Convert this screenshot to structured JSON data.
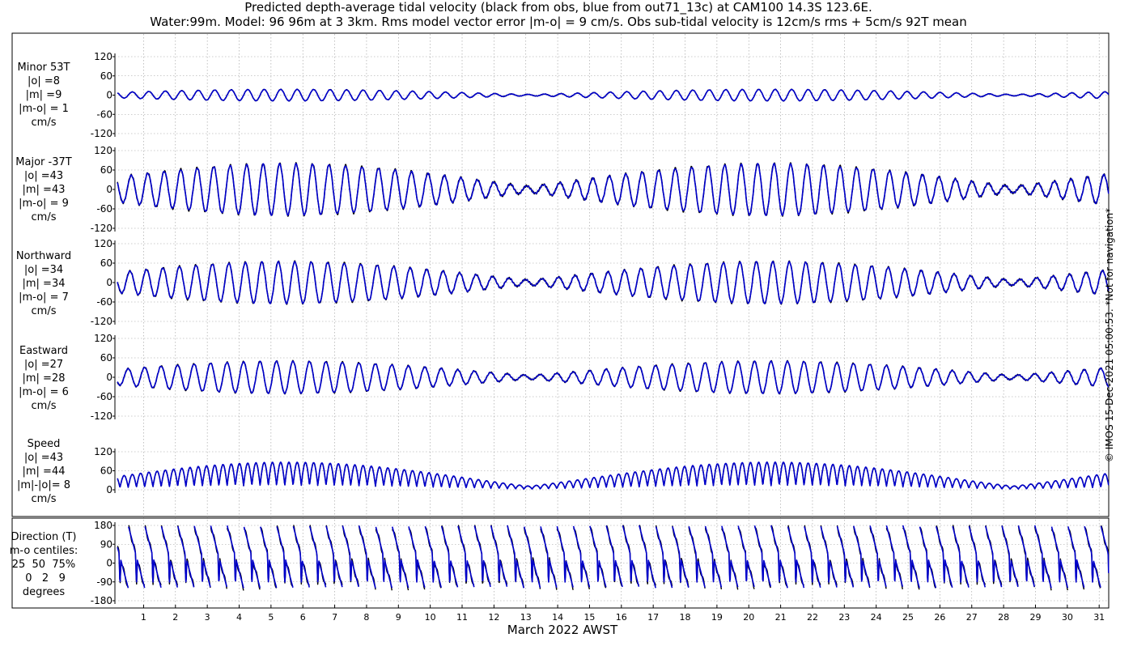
{
  "titles": {
    "line1": "Predicted depth-average tidal velocity (black from obs, blue from out71_13c) at CAM100 14.3S 123.6E.",
    "line2": "Water:99m. Model: 96 96m at 3 3km. Rms model vector error |m-o| = 9 cm/s. Obs sub-tidal velocity is 12cm/s rms + 5cm/s 92T mean"
  },
  "side_note": "© IMOS 15-Dec-2021 05:00:53. *Not for navigation*",
  "colors": {
    "obs": "#000000",
    "model": "#0000cc",
    "grid": "#999999"
  },
  "chart_data": {
    "type": "line",
    "xlabel": "March 2022 AWST",
    "x_ticks": [
      "1",
      "2",
      "3",
      "4",
      "5",
      "6",
      "7",
      "8",
      "9",
      "10",
      "11",
      "12",
      "13",
      "14",
      "15",
      "16",
      "17",
      "18",
      "19",
      "20",
      "21",
      "22",
      "23",
      "24",
      "25",
      "26",
      "27",
      "28",
      "29",
      "30",
      "31"
    ],
    "xlim_days": [
      0.1,
      31.3
    ],
    "series_names": [
      "obs",
      "model"
    ],
    "panels": [
      {
        "key": "minor",
        "label_lines": [
          "Minor 53T",
          "|o| =8",
          "|m| =9",
          "|m-o| = 1",
          "cm/s"
        ],
        "ylim": [
          -120,
          120
        ],
        "y_ticks": [
          "120",
          "60",
          "0",
          "-60",
          "-120"
        ],
        "kind": "signed",
        "peak_amplitude": 18
      },
      {
        "key": "major",
        "label_lines": [
          "Major -37T",
          "|o| =43",
          "|m| =43",
          "|m-o| = 9",
          "cm/s"
        ],
        "ylim": [
          -120,
          120
        ],
        "y_ticks": [
          "120",
          "60",
          "0",
          "-60",
          "-120"
        ],
        "kind": "signed",
        "peak_amplitude": 80
      },
      {
        "key": "northward",
        "label_lines": [
          "Northward",
          "|o| =34",
          "|m| =34",
          "|m-o| = 7",
          "cm/s"
        ],
        "ylim": [
          -120,
          120
        ],
        "y_ticks": [
          "120",
          "60",
          "0",
          "-60",
          "-120"
        ],
        "kind": "signed",
        "peak_amplitude": 65
      },
      {
        "key": "eastward",
        "label_lines": [
          "Eastward",
          "|o| =27",
          "|m| =28",
          "|m-o| = 6",
          "cm/s"
        ],
        "ylim": [
          -120,
          120
        ],
        "y_ticks": [
          "120",
          "60",
          "0",
          "-60",
          "-120"
        ],
        "kind": "signed",
        "peak_amplitude": 50
      },
      {
        "key": "speed",
        "label_lines": [
          "Speed",
          "|o| =43",
          "|m| =44",
          "|m|-|o|= 8",
          "cm/s"
        ],
        "ylim": [
          0,
          120
        ],
        "y_ticks": [
          "120",
          "60",
          "0"
        ],
        "kind": "speed",
        "peak_amplitude": 85
      },
      {
        "key": "direction",
        "label_lines": [
          "Direction (T)",
          "m-o centiles:",
          "25  50  75%",
          " 0   2   9",
          "degrees"
        ],
        "ylim": [
          -180,
          180
        ],
        "y_ticks": [
          "180",
          "90",
          "0",
          "-90",
          "-180"
        ],
        "kind": "direction",
        "peak_amplitude": 180
      }
    ]
  }
}
